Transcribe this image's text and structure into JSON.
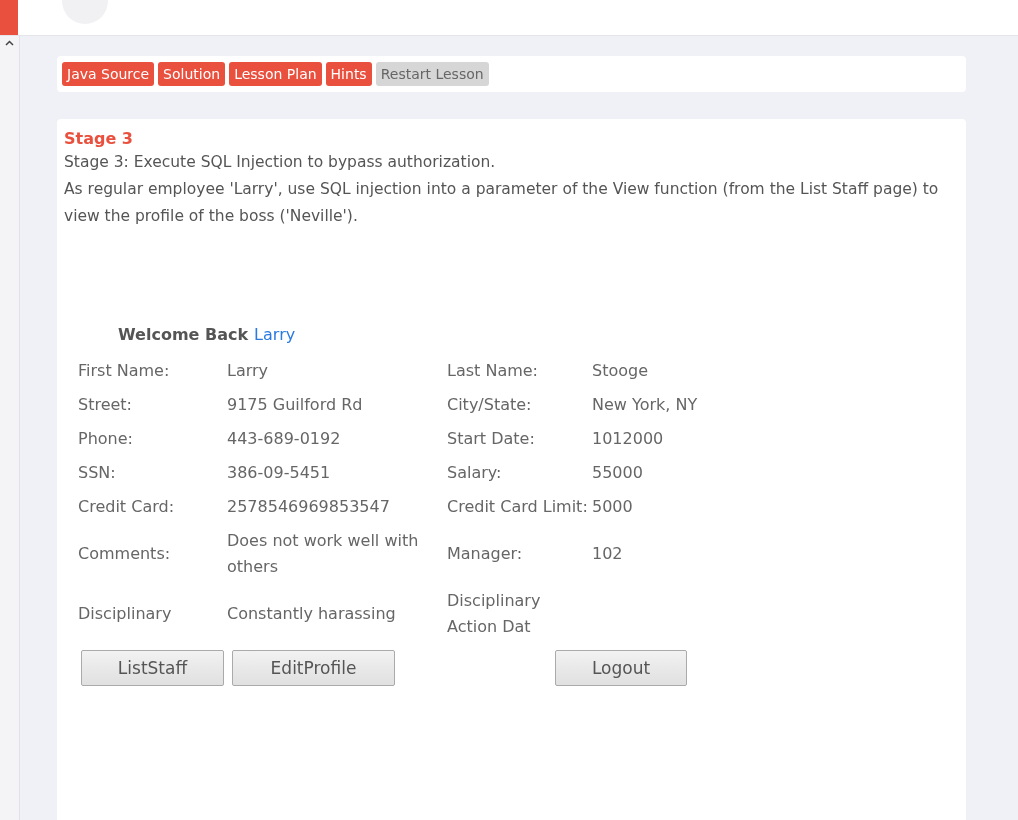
{
  "lesson_buttons": [
    {
      "label": "Java Source",
      "kind": "primary"
    },
    {
      "label": "Solution",
      "kind": "primary"
    },
    {
      "label": "Lesson Plan",
      "kind": "primary"
    },
    {
      "label": "Hints",
      "kind": "primary"
    },
    {
      "label": "Restart Lesson",
      "kind": "secondary"
    }
  ],
  "stage": {
    "title": "Stage 3",
    "lines": [
      "Stage 3: Execute SQL Injection to bypass authorization.",
      "As regular employee 'Larry', use SQL injection into a parameter of the View function (from the List Staff page) to view the profile of the boss ('Neville')."
    ]
  },
  "welcome": {
    "text": "Welcome Back",
    "name": "Larry"
  },
  "profile_rows": [
    {
      "label": "First Name:",
      "value": "Larry",
      "label2": "Last Name:",
      "value2": "Stooge"
    },
    {
      "label": "Street:",
      "value": "9175 Guilford Rd",
      "label2": "City/State:",
      "value2": "New York, NY"
    },
    {
      "label": "Phone:",
      "value": "443-689-0192",
      "label2": "Start Date:",
      "value2": "1012000"
    },
    {
      "label": "SSN:",
      "value": "386-09-5451",
      "label2": "Salary:",
      "value2": "55000"
    },
    {
      "label": "Credit Card:",
      "value": "2578546969853547",
      "label2": "Credit Card Limit:",
      "value2": "5000"
    },
    {
      "label": "Comments:",
      "value": "Does not work well with others",
      "label2": "Manager:",
      "value2": "102"
    },
    {
      "label": "Disciplinary",
      "value": "Constantly harassing",
      "label2": "Disciplinary Action Dat"
    }
  ],
  "actions": [
    "ListStaff",
    "EditProfile",
    "Logout"
  ]
}
